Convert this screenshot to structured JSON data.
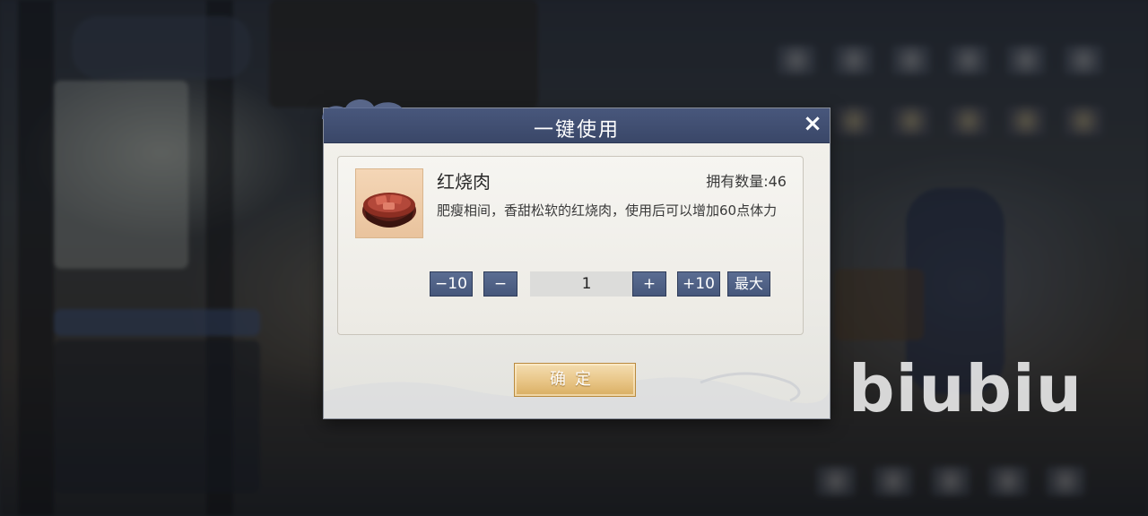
{
  "dialog": {
    "title": "一键使用",
    "close_icon": "×"
  },
  "item": {
    "name": "红烧肉",
    "owned": "拥有数量:46",
    "description": "肥瘦相间，香甜松软的红烧肉，使用后可以增加60点体力",
    "icon": "braised-pork-icon"
  },
  "quantity": {
    "minus10_label": "−10",
    "minus_label": "−",
    "value": "1",
    "plus_label": "+",
    "plus10_label": "+10",
    "max_label": "最大"
  },
  "confirm_label": "确定",
  "watermark": "biubiu",
  "colors": {
    "titlebar": "#48577c",
    "blue_button": "#4f6087",
    "confirm_gold": "#e8c586"
  }
}
